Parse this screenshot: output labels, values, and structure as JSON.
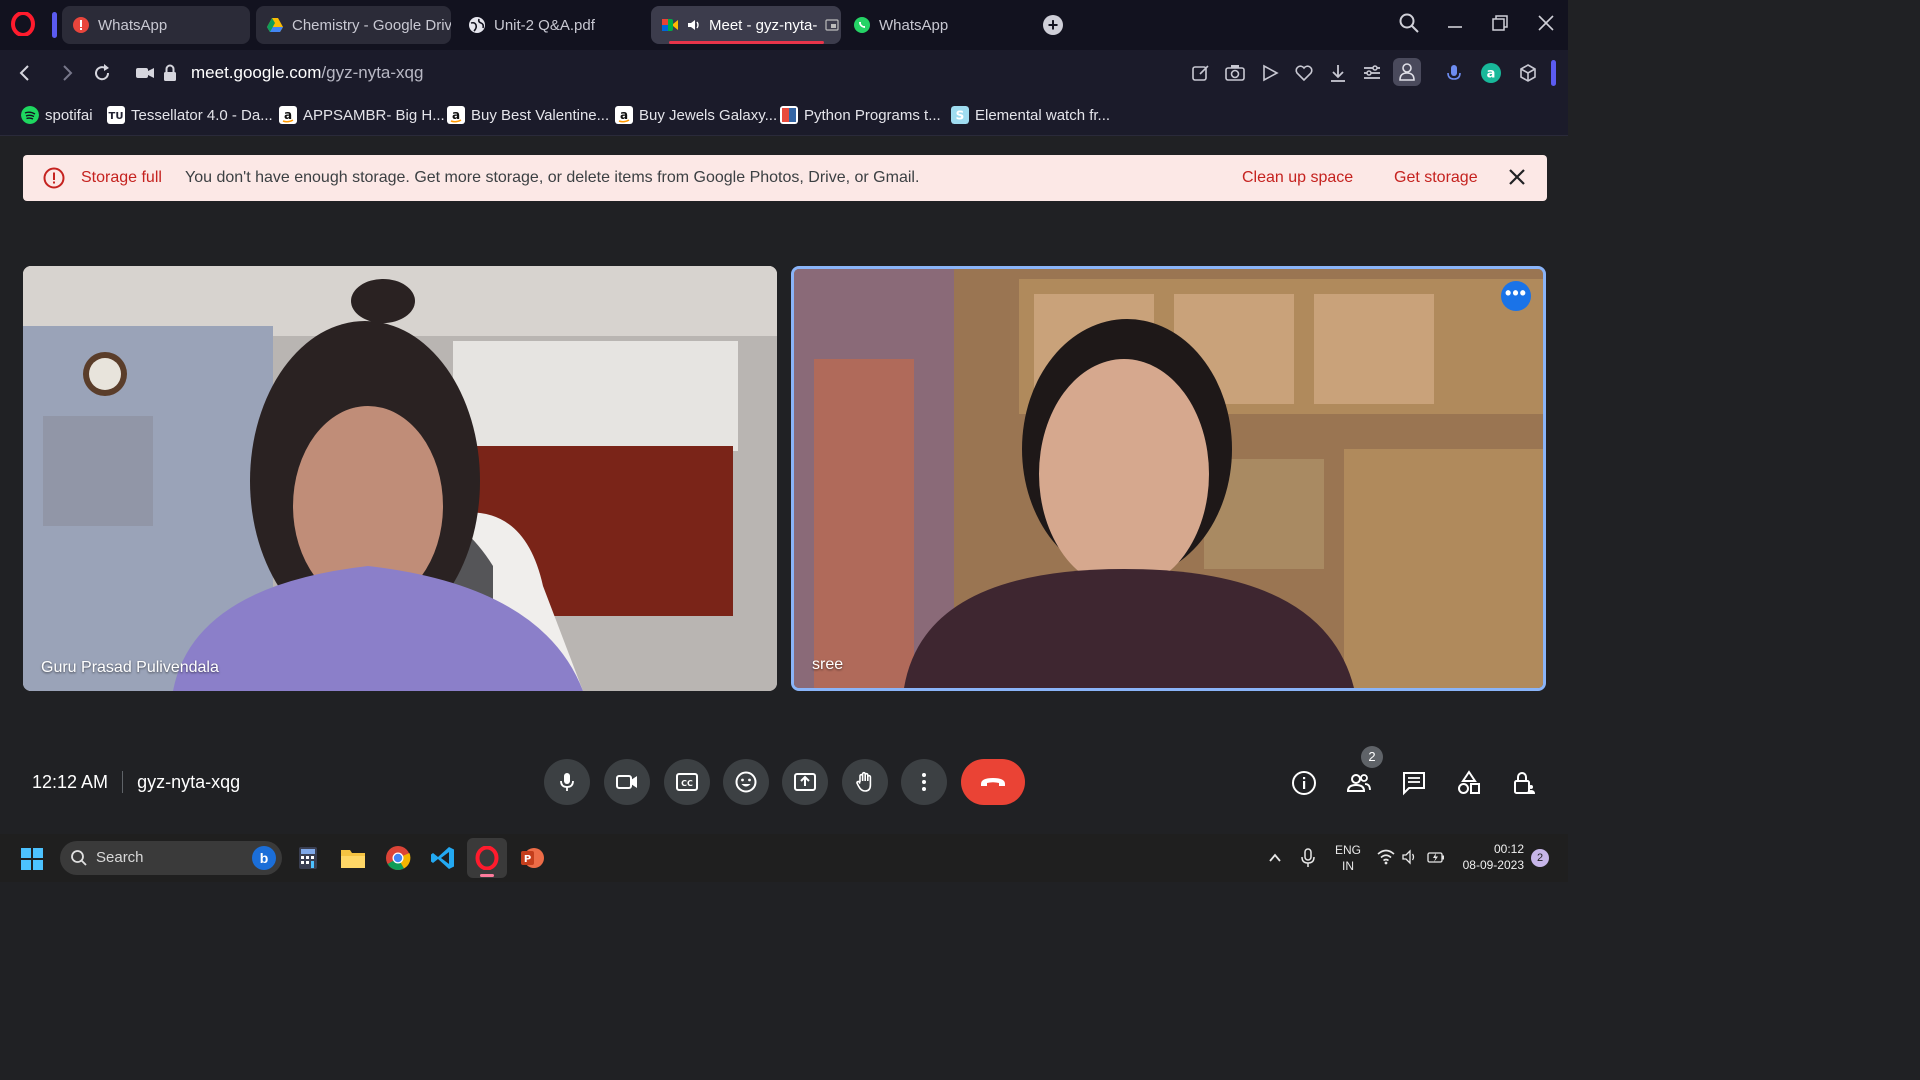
{
  "browser": {
    "tabs": [
      {
        "label": "WhatsApp"
      },
      {
        "label": "Chemistry - Google Driv"
      },
      {
        "label": "Unit-2 Q&A.pdf"
      },
      {
        "label": "Meet - gyz-nyta-"
      },
      {
        "label": "WhatsApp"
      }
    ],
    "url_host": "meet.google.com",
    "url_prefix": "",
    "url_path": "/gyz-nyta-xqg",
    "bookmarks": [
      {
        "label": "spotifai"
      },
      {
        "label": "Tessellator 4.0 - Da..."
      },
      {
        "label": "APPSAMBR- Big H..."
      },
      {
        "label": "Buy Best Valentine..."
      },
      {
        "label": "Buy Jewels Galaxy..."
      },
      {
        "label": "Python Programs t..."
      },
      {
        "label": "Elemental watch fr..."
      }
    ]
  },
  "banner": {
    "title": "Storage full",
    "message": "You don't have enough storage. Get more storage, or delete items from Google Photos, Drive, or Gmail.",
    "clean_up": "Clean up space",
    "get_storage": "Get storage"
  },
  "participants": [
    {
      "name": "Guru Prasad Pulivendala"
    },
    {
      "name": "sree"
    }
  ],
  "meeting": {
    "time": "12:12 AM",
    "code": "gyz-nyta-xqg",
    "people_count": "2"
  },
  "taskbar": {
    "search_label": "Search",
    "lang_top": "ENG",
    "lang_bottom": "IN",
    "time": "00:12",
    "date": "08-09-2023",
    "notifications": "2"
  },
  "colors": {
    "end_call": "#ea4335",
    "active_speaker_border": "#8ab4f8",
    "banner_bg": "#fce8e6",
    "banner_accent": "#c5221f"
  }
}
